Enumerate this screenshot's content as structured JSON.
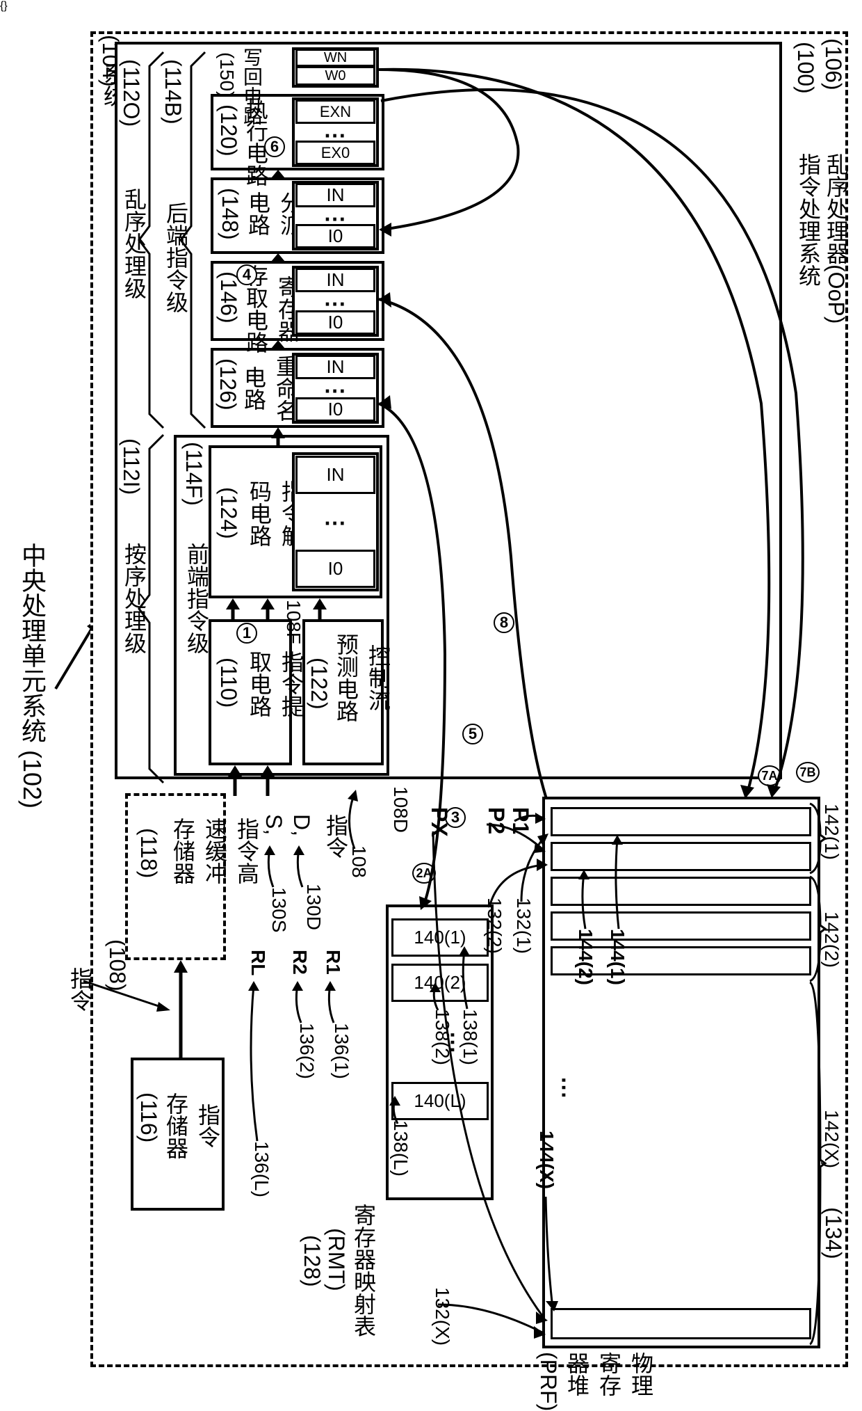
{
  "title_outer": "中央处理单元系统 (102)",
  "soc_label": "单片\n系统",
  "soc_ref": "(104)",
  "oop_label": "乱序处理器(OoP)",
  "oop_ref": "(106)",
  "ips_label": "指令处理系统",
  "ips_ref": "(100)",
  "instr_mem": "指令\n存储器",
  "instr_mem_ref": "(116)",
  "instr_word": "指令",
  "instr_ref": "(108)",
  "icache": "指令高\n速缓冲\n存储器",
  "icache_ref": "(118)",
  "inorder_stage": "按序处理级",
  "inorder_ref": "(112I)",
  "ooo_stage": "乱序处理级",
  "ooo_ref": "(112O)",
  "frontend": "前端指令级",
  "frontend_ref": "(114F)",
  "backend": "后端指令级",
  "backend_ref": "(114B)",
  "fetch": "指令提\n取电路",
  "fetch_ref": "(110)",
  "ctrlflow": "控制流\n预测电路",
  "ctrlflow_ref": "(122)",
  "decode": "指令解\n码电路",
  "decode_ref": "(124)",
  "rename": "重命名\n电路",
  "rename_ref": "(126)",
  "racc": "寄存器\n存取电路",
  "racc_ref": "(146)",
  "dispatch": "分派\n电路",
  "dispatch_ref": "(148)",
  "exec": "执行电路",
  "exec_ref": "(120)",
  "wb": "写回电路",
  "wb_ref": "(150)",
  "I0": "I0",
  "IN": "IN",
  "EX0": "EX0",
  "EXN": "EXN",
  "W0": "W0",
  "WN": "WN",
  "c1": "1",
  "c2A": "2A",
  "c3": "3",
  "c4": "4",
  "c5": "5",
  "c6": "6",
  "c7A": "7A",
  "c7B": "7B",
  "c8": "8",
  "ref108": "108",
  "ref108F": "108F",
  "ref108D": "108D",
  "instr_fmt_head": "指令",
  "D": "D,",
  "S": "S,",
  "ref130D": "130D",
  "ref130S": "130S",
  "R1": "R1",
  "R2": "R2",
  "RL": "RL",
  "ref136_1": "136(1)",
  "ref136_2": "136(2)",
  "ref136_L": "136(L)",
  "ref138_1": "138(1)",
  "ref138_2": "138(2)",
  "ref138_L": "138(L)",
  "rmt140_1": "140(1)",
  "rmt140_2": "140(2)",
  "rmt140_L": "140(L)",
  "rmt_label": "寄存器映射表",
  "rmt_abbr": "(RMT)",
  "rmt_ref": "(128)",
  "P1": "P1",
  "P2": "P2",
  "PX": "PX",
  "ref132_1": "132(1)",
  "ref132_2": "132(2)",
  "ref132_X": "132(X)",
  "ref142_1": "142(1)",
  "ref142_2": "142(2)",
  "ref142_X": "142(X)",
  "ref144_1": "144(1)",
  "ref144_2": "144(2)",
  "ref144_X": "144(X)",
  "prf_label": "物理寄存器堆(PRF)",
  "prf_ref": "(134)"
}
